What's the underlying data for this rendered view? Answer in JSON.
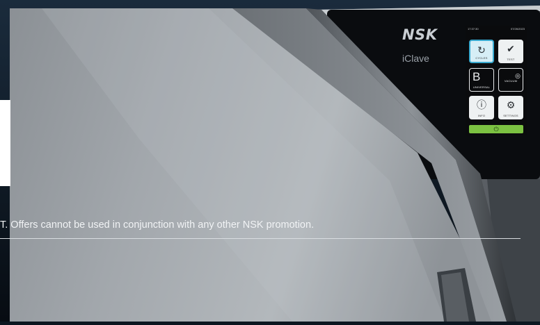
{
  "brand": {
    "logo": "NSK",
    "model": "iClave"
  },
  "screen": {
    "time": "17:37:30",
    "date": "07/26/2023",
    "tiles": [
      {
        "label": "CYCLES",
        "icon": "refresh-icon"
      },
      {
        "label": "TEST",
        "icon": "check-circle-icon"
      },
      {
        "label": "UNIVERSAL",
        "letter": "B",
        "icon": "b-cycle-icon"
      },
      {
        "label": "VACUUM",
        "icon": "gauge-icon"
      },
      {
        "label": "INFO",
        "icon": "info-icon"
      },
      {
        "label": "SETTINGS",
        "icon": "gear-icon"
      }
    ],
    "start_icon": "power-icon"
  },
  "disclaimer": "T. Offers cannot be used in conjunction with any other NSK promotion.",
  "colors": {
    "background": "#0c1620",
    "accent_blue": "#39aad0",
    "start_green": "#7cc242",
    "door_light": "#a9aeb3",
    "door_dark": "#5f6469"
  }
}
